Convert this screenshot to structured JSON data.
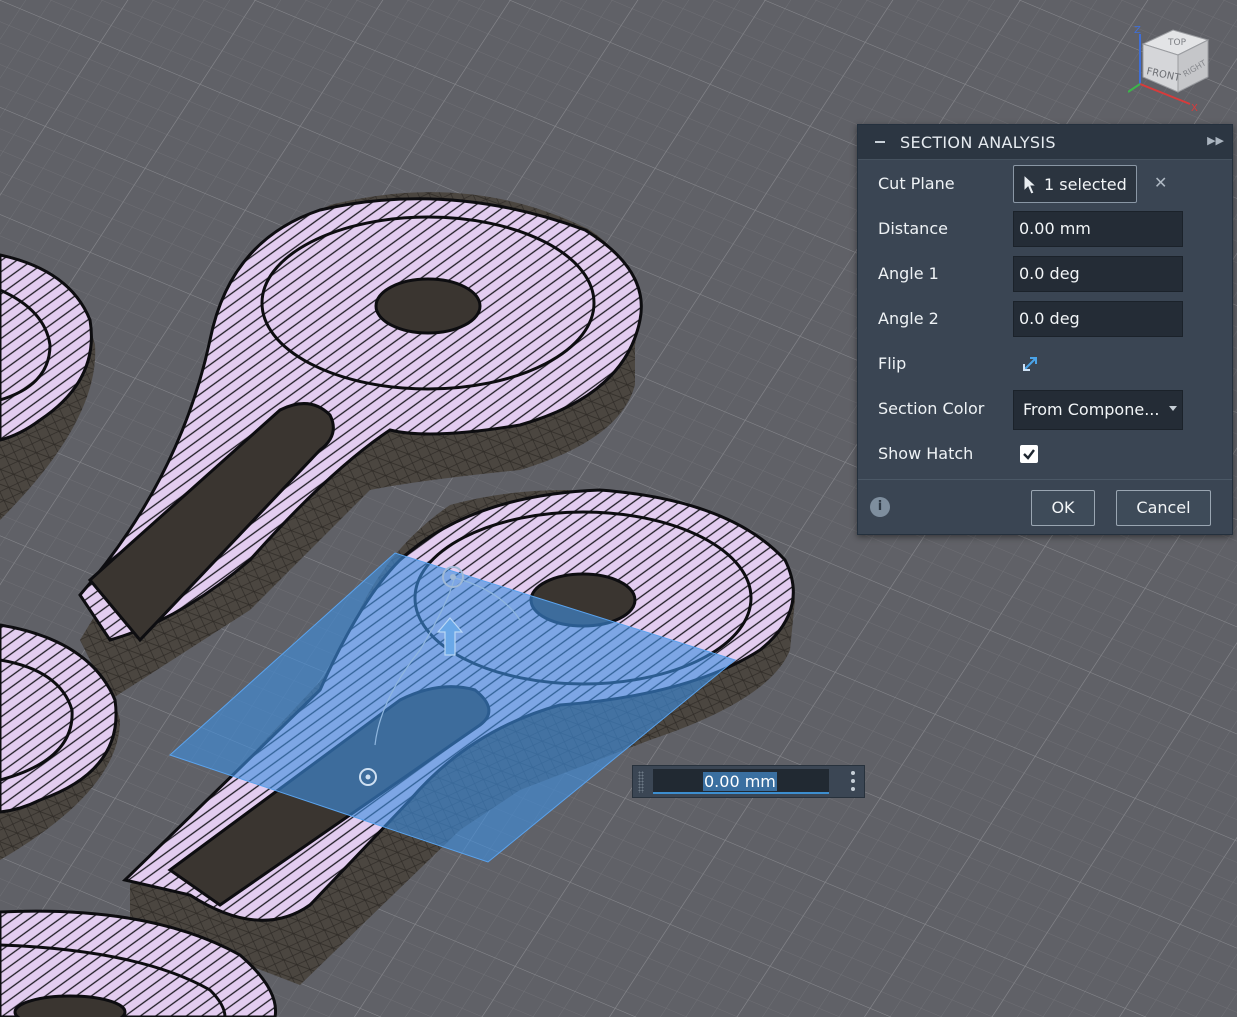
{
  "viewcube": {
    "top": "TOP",
    "front": "FRONT",
    "right": "RIGHT",
    "axis_z": "Z",
    "axis_x": "X"
  },
  "panel": {
    "title": "SECTION ANALYSIS",
    "cut_plane": {
      "label": "Cut Plane",
      "value": "1 selected"
    },
    "distance": {
      "label": "Distance",
      "value": "0.00 mm"
    },
    "angle1": {
      "label": "Angle 1",
      "value": "0.0 deg"
    },
    "angle2": {
      "label": "Angle 2",
      "value": "0.0 deg"
    },
    "flip": {
      "label": "Flip"
    },
    "section_color": {
      "label": "Section Color",
      "value": "From Compone..."
    },
    "show_hatch": {
      "label": "Show Hatch",
      "checked": true
    },
    "ok_label": "OK",
    "cancel_label": "Cancel"
  },
  "distance_manipulator": {
    "value": "0.00 mm"
  },
  "colors": {
    "section_face": "#e3cdf0",
    "hatch": "#1c1b22",
    "wall": "#4b4640",
    "cut_plane": "#3f8ede",
    "panel_bg": "#3a4553",
    "accent": "#3d8ecf"
  },
  "icons": [
    "cursor-icon",
    "close-icon",
    "flip-icon",
    "chevron-down-icon",
    "check-icon",
    "info-icon",
    "collapse-icon",
    "expand-icon",
    "kebab-icon",
    "grip-icon"
  ]
}
